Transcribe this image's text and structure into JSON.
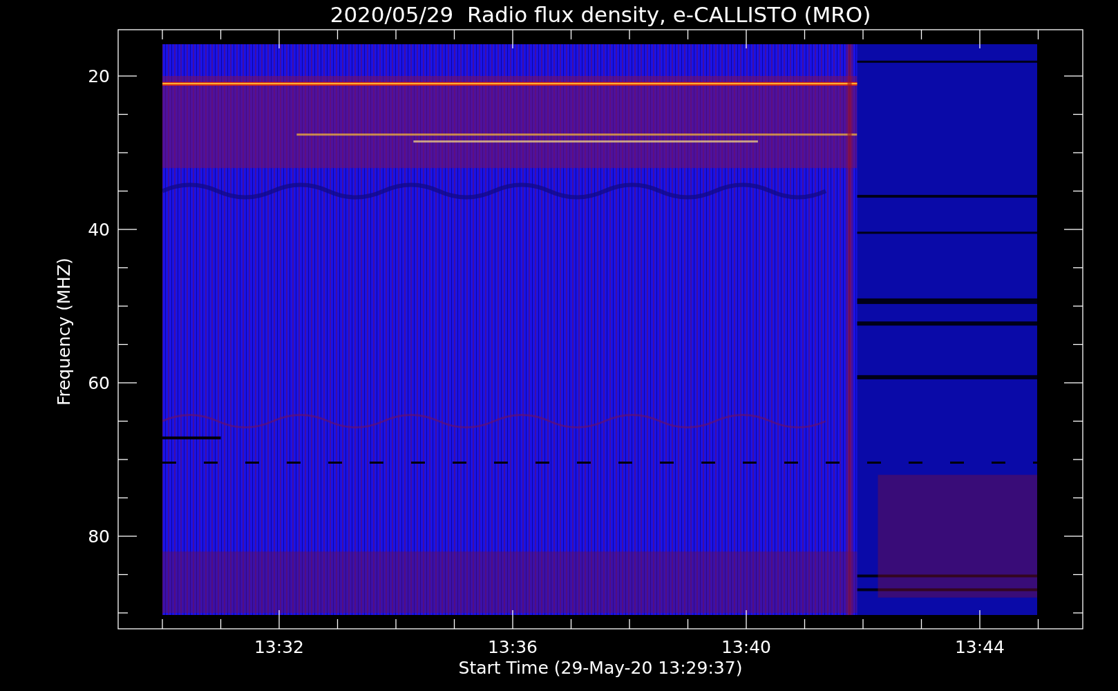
{
  "title": "2020/05/29  Radio flux density, e-CALLISTO (MRO)",
  "y_axis": {
    "label": "Frequency (MHZ)",
    "ticks": [
      "20",
      "40",
      "60",
      "80"
    ]
  },
  "x_axis": {
    "label": "Start Time (29-May-20 13:29:37)",
    "ticks": [
      "13:32",
      "13:36",
      "13:40",
      "13:44"
    ]
  }
}
